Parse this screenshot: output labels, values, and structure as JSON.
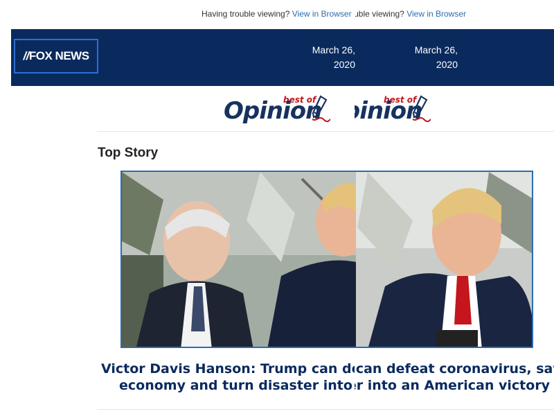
{
  "topbar": {
    "trouble_text": "Having trouble viewing?",
    "view_link": "View in Browser"
  },
  "header": {
    "logo_text": "FOX NEWS",
    "date_line1": "March 26,",
    "date_line2": "2020"
  },
  "banner": {
    "best_of": "best of",
    "opinion": "Opinion"
  },
  "section": {
    "title": "Top Story"
  },
  "story": {
    "headline_line1": "Victor Davis Hanson: Trump can defeat coronavirus, save",
    "headline_line2": "economy and turn disaster into an American victory"
  },
  "colors": {
    "header_bg": "#0a2a5e",
    "link": "#2b6cb0",
    "accent_red": "#c4161c",
    "headline": "#0a2a5e"
  }
}
